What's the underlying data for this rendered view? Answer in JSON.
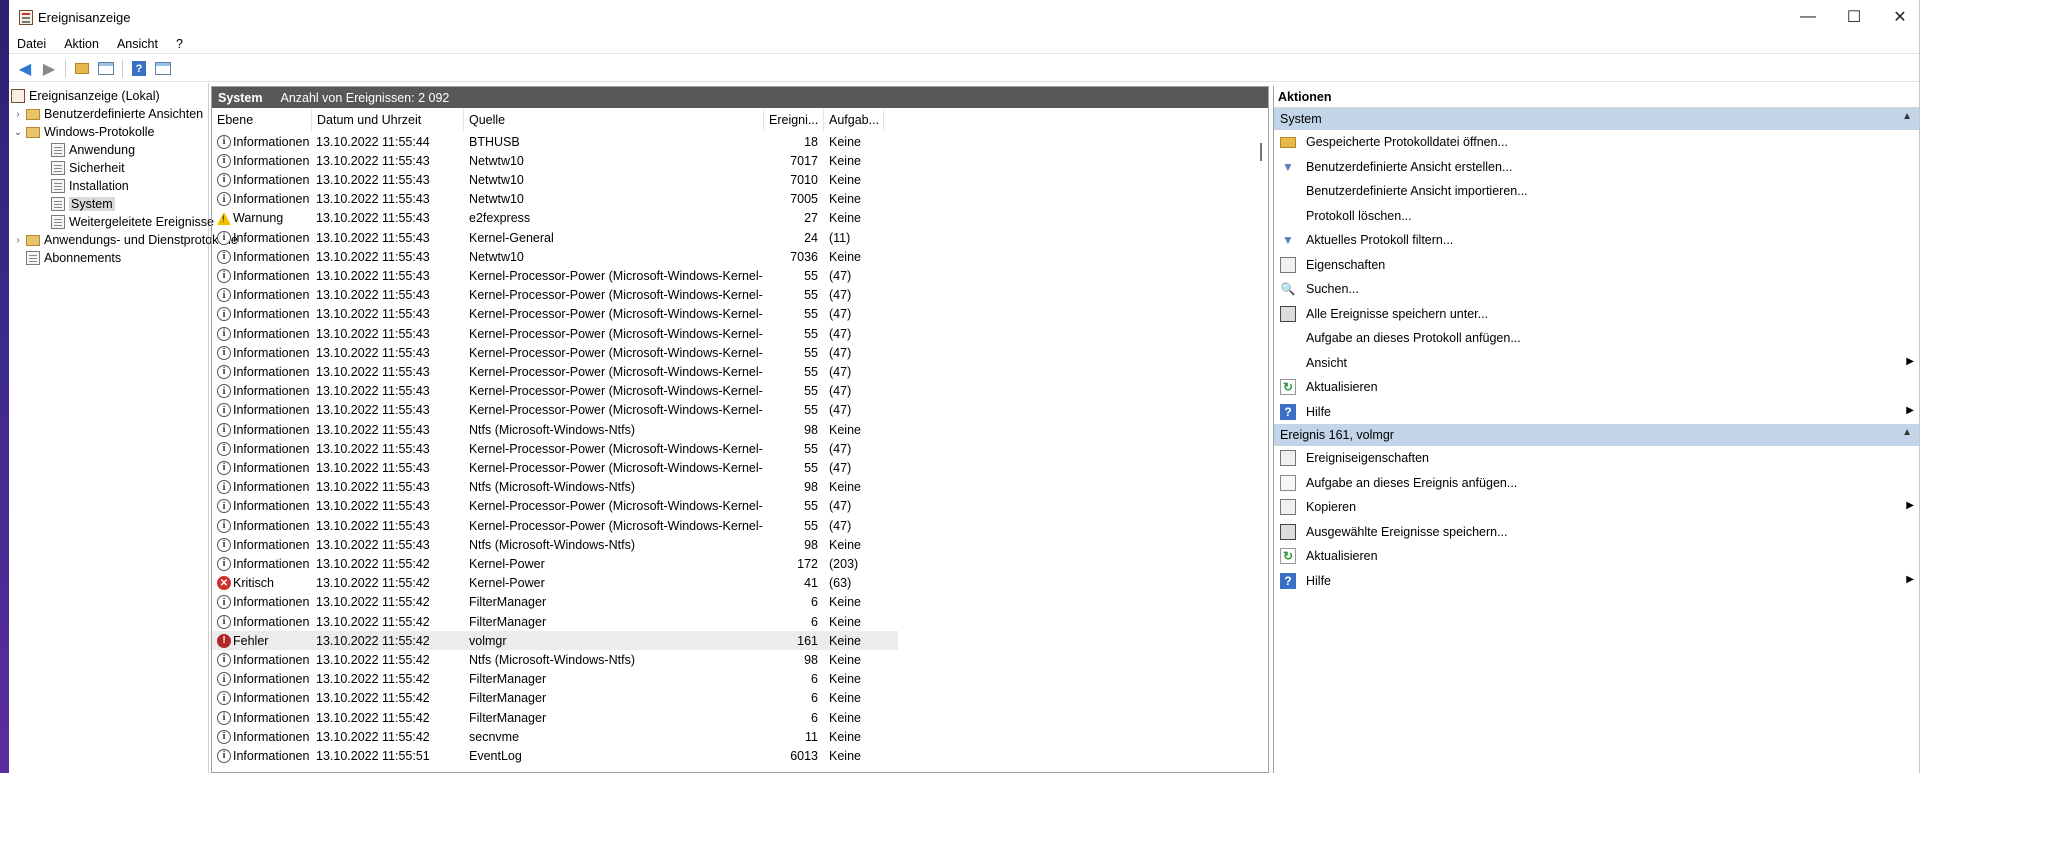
{
  "window": {
    "title": "Ereignisanzeige",
    "minimize": "—",
    "maximize": "☐",
    "close": "✕"
  },
  "menu": [
    "Datei",
    "Aktion",
    "Ansicht",
    "?"
  ],
  "toolbar": {
    "back_icon": "back-arrow-icon",
    "forward_icon": "forward-arrow-icon"
  },
  "tree": {
    "items": [
      {
        "label": "Ereignisanzeige (Lokal)",
        "icon": "root",
        "level": 0,
        "chevron": ""
      },
      {
        "label": "Benutzerdefinierte Ansichten",
        "icon": "folder",
        "level": 0,
        "chevron": "›"
      },
      {
        "label": "Windows-Protokolle",
        "icon": "folder",
        "level": 0,
        "chevron": "⌄"
      },
      {
        "label": "Anwendung",
        "icon": "log",
        "level": 1,
        "chevron": ""
      },
      {
        "label": "Sicherheit",
        "icon": "log",
        "level": 1,
        "chevron": ""
      },
      {
        "label": "Installation",
        "icon": "log",
        "level": 1,
        "chevron": ""
      },
      {
        "label": "System",
        "icon": "log",
        "level": 1,
        "chevron": "",
        "selected": true
      },
      {
        "label": "Weitergeleitete Ereignisse",
        "icon": "log",
        "level": 1,
        "chevron": ""
      },
      {
        "label": "Anwendungs- und Dienstprotokolle",
        "icon": "folder",
        "level": 0,
        "chevron": "›"
      },
      {
        "label": "Abonnements",
        "icon": "log",
        "level": 0,
        "chevron": ""
      }
    ]
  },
  "center": {
    "title": "System",
    "count_text": "Anzahl von Ereignissen: 2 092",
    "columns": [
      "Ebene",
      "Datum und Uhrzeit",
      "Quelle",
      "Ereigni...",
      "Aufgab..."
    ],
    "rows": [
      {
        "level": "Informationen",
        "type": "info",
        "date": "13.10.2022 11:55:44",
        "source": "BTHUSB",
        "id": "18",
        "task": "Keine"
      },
      {
        "level": "Informationen",
        "type": "info",
        "date": "13.10.2022 11:55:43",
        "source": "Netwtw10",
        "id": "7017",
        "task": "Keine"
      },
      {
        "level": "Informationen",
        "type": "info",
        "date": "13.10.2022 11:55:43",
        "source": "Netwtw10",
        "id": "7010",
        "task": "Keine"
      },
      {
        "level": "Informationen",
        "type": "info",
        "date": "13.10.2022 11:55:43",
        "source": "Netwtw10",
        "id": "7005",
        "task": "Keine"
      },
      {
        "level": "Warnung",
        "type": "warn",
        "date": "13.10.2022 11:55:43",
        "source": "e2fexpress",
        "id": "27",
        "task": "Keine"
      },
      {
        "level": "Informationen",
        "type": "info",
        "date": "13.10.2022 11:55:43",
        "source": "Kernel-General",
        "id": "24",
        "task": "(11)"
      },
      {
        "level": "Informationen",
        "type": "info",
        "date": "13.10.2022 11:55:43",
        "source": "Netwtw10",
        "id": "7036",
        "task": "Keine"
      },
      {
        "level": "Informationen",
        "type": "info",
        "date": "13.10.2022 11:55:43",
        "source": "Kernel-Processor-Power (Microsoft-Windows-Kernel-...",
        "id": "55",
        "task": "(47)"
      },
      {
        "level": "Informationen",
        "type": "info",
        "date": "13.10.2022 11:55:43",
        "source": "Kernel-Processor-Power (Microsoft-Windows-Kernel-...",
        "id": "55",
        "task": "(47)"
      },
      {
        "level": "Informationen",
        "type": "info",
        "date": "13.10.2022 11:55:43",
        "source": "Kernel-Processor-Power (Microsoft-Windows-Kernel-...",
        "id": "55",
        "task": "(47)"
      },
      {
        "level": "Informationen",
        "type": "info",
        "date": "13.10.2022 11:55:43",
        "source": "Kernel-Processor-Power (Microsoft-Windows-Kernel-...",
        "id": "55",
        "task": "(47)"
      },
      {
        "level": "Informationen",
        "type": "info",
        "date": "13.10.2022 11:55:43",
        "source": "Kernel-Processor-Power (Microsoft-Windows-Kernel-...",
        "id": "55",
        "task": "(47)"
      },
      {
        "level": "Informationen",
        "type": "info",
        "date": "13.10.2022 11:55:43",
        "source": "Kernel-Processor-Power (Microsoft-Windows-Kernel-...",
        "id": "55",
        "task": "(47)"
      },
      {
        "level": "Informationen",
        "type": "info",
        "date": "13.10.2022 11:55:43",
        "source": "Kernel-Processor-Power (Microsoft-Windows-Kernel-...",
        "id": "55",
        "task": "(47)"
      },
      {
        "level": "Informationen",
        "type": "info",
        "date": "13.10.2022 11:55:43",
        "source": "Kernel-Processor-Power (Microsoft-Windows-Kernel-...",
        "id": "55",
        "task": "(47)"
      },
      {
        "level": "Informationen",
        "type": "info",
        "date": "13.10.2022 11:55:43",
        "source": "Ntfs (Microsoft-Windows-Ntfs)",
        "id": "98",
        "task": "Keine"
      },
      {
        "level": "Informationen",
        "type": "info",
        "date": "13.10.2022 11:55:43",
        "source": "Kernel-Processor-Power (Microsoft-Windows-Kernel-...",
        "id": "55",
        "task": "(47)"
      },
      {
        "level": "Informationen",
        "type": "info",
        "date": "13.10.2022 11:55:43",
        "source": "Kernel-Processor-Power (Microsoft-Windows-Kernel-...",
        "id": "55",
        "task": "(47)"
      },
      {
        "level": "Informationen",
        "type": "info",
        "date": "13.10.2022 11:55:43",
        "source": "Ntfs (Microsoft-Windows-Ntfs)",
        "id": "98",
        "task": "Keine"
      },
      {
        "level": "Informationen",
        "type": "info",
        "date": "13.10.2022 11:55:43",
        "source": "Kernel-Processor-Power (Microsoft-Windows-Kernel-...",
        "id": "55",
        "task": "(47)"
      },
      {
        "level": "Informationen",
        "type": "info",
        "date": "13.10.2022 11:55:43",
        "source": "Kernel-Processor-Power (Microsoft-Windows-Kernel-...",
        "id": "55",
        "task": "(47)"
      },
      {
        "level": "Informationen",
        "type": "info",
        "date": "13.10.2022 11:55:43",
        "source": "Ntfs (Microsoft-Windows-Ntfs)",
        "id": "98",
        "task": "Keine"
      },
      {
        "level": "Informationen",
        "type": "info",
        "date": "13.10.2022 11:55:42",
        "source": "Kernel-Power",
        "id": "172",
        "task": "(203)"
      },
      {
        "level": "Kritisch",
        "type": "crit",
        "date": "13.10.2022 11:55:42",
        "source": "Kernel-Power",
        "id": "41",
        "task": "(63)"
      },
      {
        "level": "Informationen",
        "type": "info",
        "date": "13.10.2022 11:55:42",
        "source": "FilterManager",
        "id": "6",
        "task": "Keine"
      },
      {
        "level": "Informationen",
        "type": "info",
        "date": "13.10.2022 11:55:42",
        "source": "FilterManager",
        "id": "6",
        "task": "Keine"
      },
      {
        "level": "Fehler",
        "type": "err",
        "date": "13.10.2022 11:55:42",
        "source": "volmgr",
        "id": "161",
        "task": "Keine",
        "selected": true
      },
      {
        "level": "Informationen",
        "type": "info",
        "date": "13.10.2022 11:55:42",
        "source": "Ntfs (Microsoft-Windows-Ntfs)",
        "id": "98",
        "task": "Keine"
      },
      {
        "level": "Informationen",
        "type": "info",
        "date": "13.10.2022 11:55:42",
        "source": "FilterManager",
        "id": "6",
        "task": "Keine"
      },
      {
        "level": "Informationen",
        "type": "info",
        "date": "13.10.2022 11:55:42",
        "source": "FilterManager",
        "id": "6",
        "task": "Keine"
      },
      {
        "level": "Informationen",
        "type": "info",
        "date": "13.10.2022 11:55:42",
        "source": "FilterManager",
        "id": "6",
        "task": "Keine"
      },
      {
        "level": "Informationen",
        "type": "info",
        "date": "13.10.2022 11:55:42",
        "source": "secnvme",
        "id": "11",
        "task": "Keine"
      },
      {
        "level": "Informationen",
        "type": "info",
        "date": "13.10.2022 11:55:51",
        "source": "EventLog",
        "id": "6013",
        "task": "Keine"
      }
    ]
  },
  "actions": {
    "title": "Aktionen",
    "sections": [
      {
        "title": "System",
        "items": [
          {
            "label": "Gespeicherte Protokolldatei öffnen...",
            "icon": "folder",
            "submenu": false
          },
          {
            "label": "Benutzerdefinierte Ansicht erstellen...",
            "icon": "filter",
            "submenu": false
          },
          {
            "label": "Benutzerdefinierte Ansicht importieren...",
            "icon": "none",
            "submenu": false
          },
          {
            "label": "Protokoll löschen...",
            "icon": "none",
            "submenu": false
          },
          {
            "label": "Aktuelles Protokoll filtern...",
            "icon": "filter",
            "submenu": false
          },
          {
            "label": "Eigenschaften",
            "icon": "props",
            "submenu": false
          },
          {
            "label": "Suchen...",
            "icon": "find",
            "submenu": false
          },
          {
            "label": "Alle Ereignisse speichern unter...",
            "icon": "save",
            "submenu": false
          },
          {
            "label": "Aufgabe an dieses Protokoll anfügen...",
            "icon": "none",
            "submenu": false
          },
          {
            "label": "Ansicht",
            "icon": "none",
            "submenu": true
          },
          {
            "label": "Aktualisieren",
            "icon": "refresh",
            "submenu": false
          },
          {
            "label": "Hilfe",
            "icon": "help",
            "submenu": true
          }
        ]
      },
      {
        "title": "Ereignis 161, volmgr",
        "items": [
          {
            "label": "Ereigniseigenschaften",
            "icon": "props",
            "submenu": false
          },
          {
            "label": "Aufgabe an dieses Ereignis anfügen...",
            "icon": "task",
            "submenu": false
          },
          {
            "label": "Kopieren",
            "icon": "copy",
            "submenu": true
          },
          {
            "label": "Ausgewählte Ereignisse speichern...",
            "icon": "save",
            "submenu": false
          },
          {
            "label": "Aktualisieren",
            "icon": "refresh",
            "submenu": false
          },
          {
            "label": "Hilfe",
            "icon": "help",
            "submenu": true
          }
        ]
      }
    ]
  }
}
